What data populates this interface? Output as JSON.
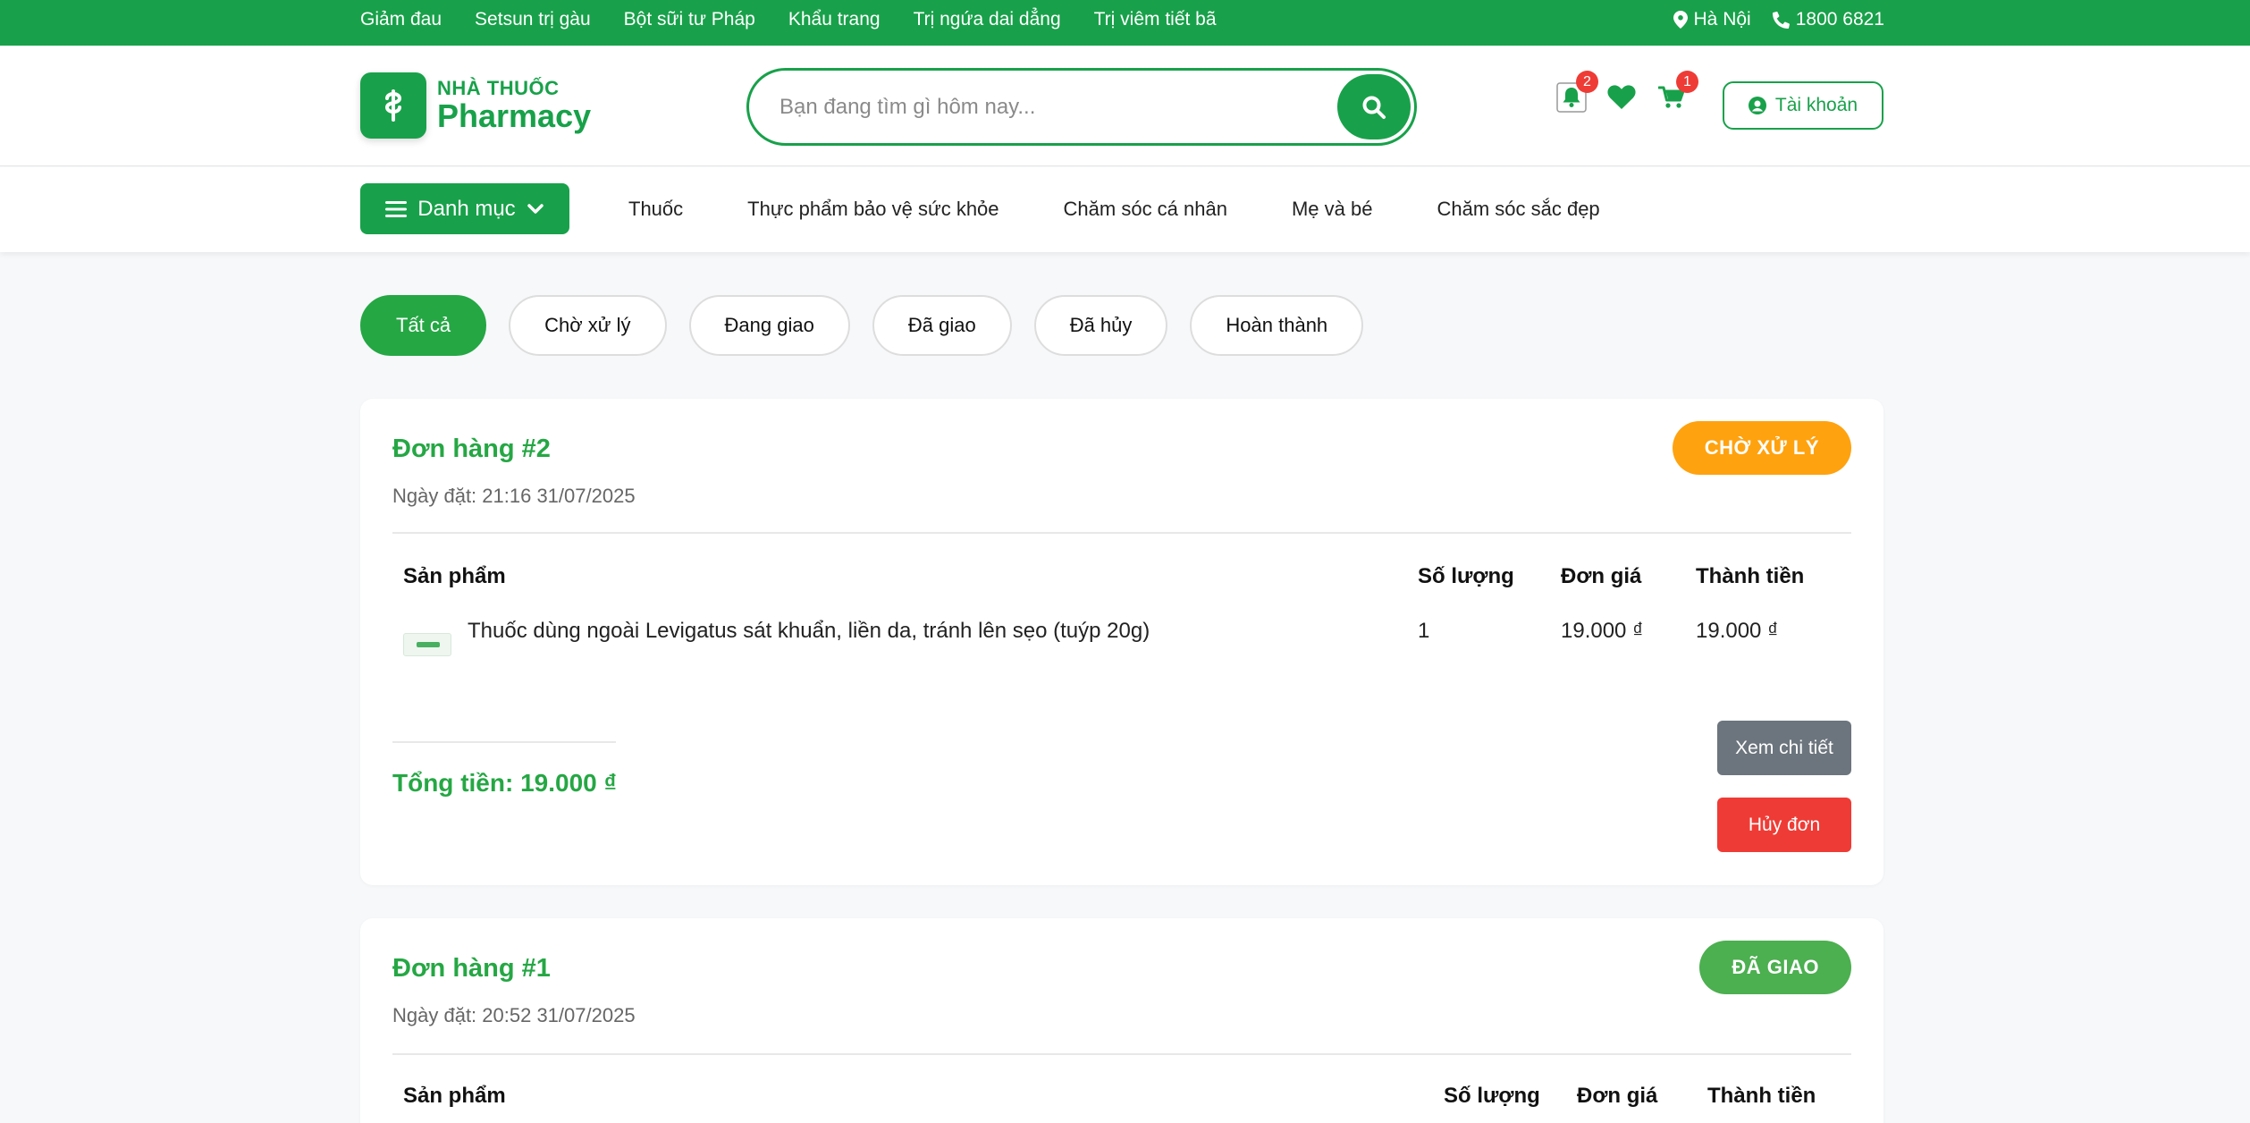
{
  "topbar": {
    "links": [
      "Giảm đau",
      "Setsun trị gàu",
      "Bột sữi tư Pháp",
      "Khẩu trang",
      "Trị ngứa dai dẳng",
      "Trị viêm tiết bã"
    ],
    "location": "Hà Nội",
    "phone": "1800 6821"
  },
  "header": {
    "logo_small": "NHÀ THUỐC",
    "logo_big": "Pharmacy",
    "search_placeholder": "Bạn đang tìm gì hôm nay...",
    "notification_count": "2",
    "cart_count": "1",
    "account_label": "Tài khoản"
  },
  "nav": {
    "category_label": "Danh mục",
    "links": [
      "Thuốc",
      "Thực phẩm bảo vệ sức khỏe",
      "Chăm sóc cá nhân",
      "Mẹ và bé",
      "Chăm sóc sắc đẹp"
    ]
  },
  "filters": [
    "Tất cả",
    "Chờ xử lý",
    "Đang giao",
    "Đã giao",
    "Đã hủy",
    "Hoàn thành"
  ],
  "colors": {
    "brand": "#18a14a",
    "pending": "#ffa20f",
    "delivered": "#4caf50",
    "danger": "#ef3b35",
    "neutral": "#6c757d"
  },
  "orders": [
    {
      "title": "Đơn hàng #2",
      "date": "Ngày đặt: 21:16 31/07/2025",
      "status": "CHỜ XỬ LÝ",
      "columns": [
        "Sản phẩm",
        "Số lượng",
        "Đơn giá",
        "Thành tiền"
      ],
      "items": [
        {
          "name": "Thuốc dùng ngoài Levigatus sát khuẩn, liền da, tránh lên sẹo (tuýp 20g)",
          "qty": "1",
          "price": "19.000 ₫",
          "subtotal": "19.000 ₫"
        }
      ],
      "total": "Tổng tiền: 19.000 ₫",
      "detail_label": "Xem chi tiết",
      "cancel_label": "Hủy đơn"
    },
    {
      "title": "Đơn hàng #1",
      "date": "Ngày đặt: 20:52 31/07/2025",
      "status": "ĐÃ GIAO",
      "columns": [
        "Sản phẩm",
        "Số lượng",
        "Đơn giá",
        "Thành tiền"
      ]
    }
  ]
}
